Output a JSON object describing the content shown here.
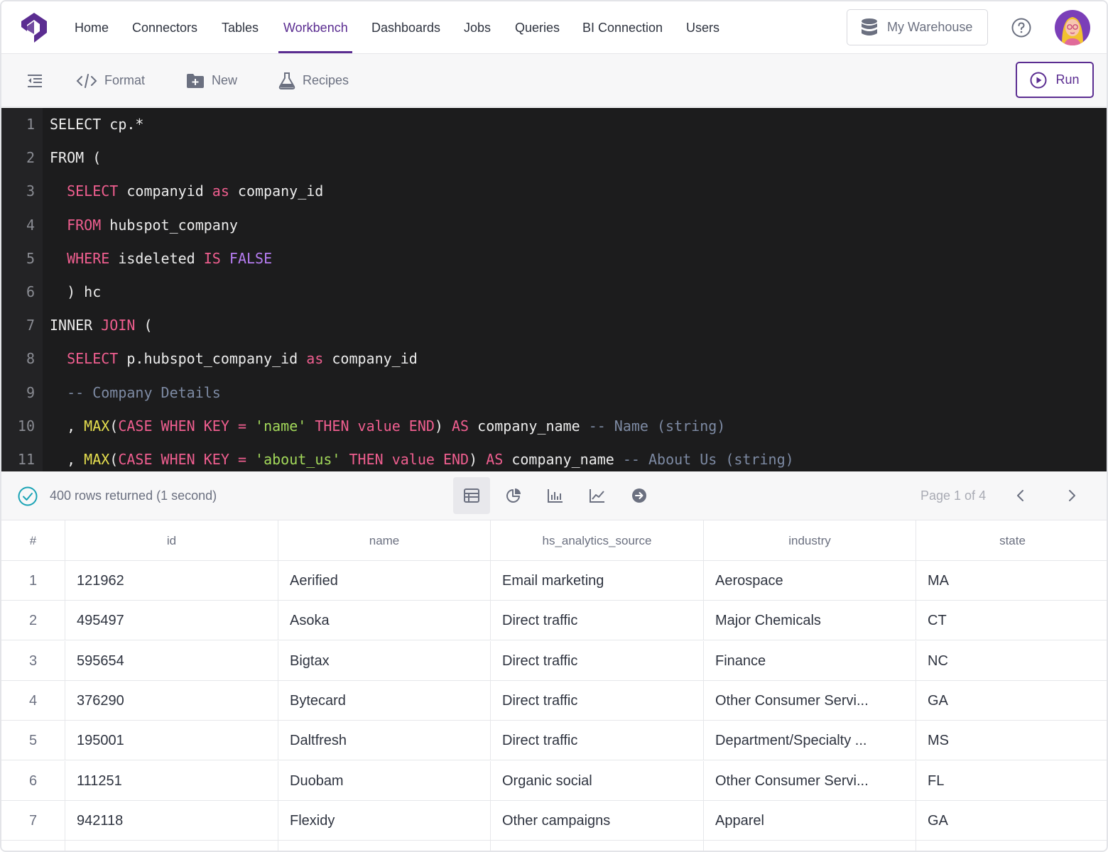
{
  "nav": {
    "items": [
      {
        "label": "Home",
        "active": false
      },
      {
        "label": "Connectors",
        "active": false
      },
      {
        "label": "Tables",
        "active": false
      },
      {
        "label": "Workbench",
        "active": true
      },
      {
        "label": "Dashboards",
        "active": false
      },
      {
        "label": "Jobs",
        "active": false
      },
      {
        "label": "Queries",
        "active": false
      },
      {
        "label": "BI Connection",
        "active": false
      },
      {
        "label": "Users",
        "active": false
      }
    ],
    "warehouse_label": "My Warehouse"
  },
  "toolbar": {
    "format_label": "Format",
    "new_label": "New",
    "recipes_label": "Recipes",
    "run_label": "Run"
  },
  "editor": {
    "lines": [
      {
        "n": "1",
        "tokens": [
          [
            "t",
            "SELECT cp.*"
          ]
        ]
      },
      {
        "n": "2",
        "tokens": [
          [
            "t",
            "FROM ("
          ]
        ]
      },
      {
        "n": "3",
        "tokens": [
          [
            "t",
            "  "
          ],
          [
            "kw",
            "SELECT"
          ],
          [
            "t",
            " companyid "
          ],
          [
            "kw",
            "as"
          ],
          [
            "t",
            " company_id"
          ]
        ]
      },
      {
        "n": "4",
        "tokens": [
          [
            "t",
            "  "
          ],
          [
            "kw",
            "FROM"
          ],
          [
            "t",
            " hubspot_company"
          ]
        ]
      },
      {
        "n": "5",
        "tokens": [
          [
            "t",
            "  "
          ],
          [
            "kw",
            "WHERE"
          ],
          [
            "t",
            " isdeleted "
          ],
          [
            "kw",
            "IS"
          ],
          [
            "t",
            " "
          ],
          [
            "bool",
            "FALSE"
          ]
        ]
      },
      {
        "n": "6",
        "tokens": [
          [
            "t",
            "  ) hc"
          ]
        ]
      },
      {
        "n": "7",
        "tokens": [
          [
            "t",
            "INNER "
          ],
          [
            "kw",
            "JOIN"
          ],
          [
            "t",
            " ("
          ]
        ]
      },
      {
        "n": "8",
        "tokens": [
          [
            "t",
            "  "
          ],
          [
            "kw",
            "SELECT"
          ],
          [
            "t",
            " p.hubspot_company_id "
          ],
          [
            "kw",
            "as"
          ],
          [
            "t",
            " company_id"
          ]
        ]
      },
      {
        "n": "9",
        "tokens": [
          [
            "cmt",
            "  -- Company Details"
          ]
        ]
      },
      {
        "n": "10",
        "tokens": [
          [
            "t",
            "  , "
          ],
          [
            "fn",
            "MAX"
          ],
          [
            "t",
            "("
          ],
          [
            "kw",
            "CASE WHEN KEY"
          ],
          [
            "t",
            " "
          ],
          [
            "kw",
            "="
          ],
          [
            "t",
            " "
          ],
          [
            "str",
            "'name'"
          ],
          [
            "t",
            " "
          ],
          [
            "kw",
            "THEN"
          ],
          [
            "t",
            " "
          ],
          [
            "kw",
            "value END"
          ],
          [
            "t",
            ") "
          ],
          [
            "kw",
            "AS"
          ],
          [
            "t",
            " company_name "
          ],
          [
            "cmt",
            "-- Name (string)"
          ]
        ]
      },
      {
        "n": "11",
        "tokens": [
          [
            "t",
            "  , "
          ],
          [
            "fn",
            "MAX"
          ],
          [
            "t",
            "("
          ],
          [
            "kw",
            "CASE WHEN KEY"
          ],
          [
            "t",
            " "
          ],
          [
            "kw",
            "="
          ],
          [
            "t",
            " "
          ],
          [
            "str",
            "'about_us'"
          ],
          [
            "t",
            " "
          ],
          [
            "kw",
            "THEN"
          ],
          [
            "t",
            " "
          ],
          [
            "kw",
            "value END"
          ],
          [
            "t",
            ") "
          ],
          [
            "kw",
            "AS"
          ],
          [
            "t",
            " company_name "
          ],
          [
            "cmt",
            "-- About Us (string)"
          ]
        ]
      }
    ]
  },
  "results": {
    "status": "400 rows returned (1 second)",
    "page": "Page 1 of 4",
    "columns": [
      "#",
      "id",
      "name",
      "hs_analytics_source",
      "industry",
      "state"
    ],
    "rows": [
      [
        "1",
        "121962",
        "Aerified",
        "Email marketing",
        "Aerospace",
        "MA"
      ],
      [
        "2",
        "495497",
        "Asoka",
        "Direct traffic",
        "Major Chemicals",
        "CT"
      ],
      [
        "3",
        "595654",
        "Bigtax",
        "Direct traffic",
        "Finance",
        "NC"
      ],
      [
        "4",
        "376290",
        "Bytecard",
        "Direct traffic",
        "Other Consumer Servi...",
        "GA"
      ],
      [
        "5",
        "195001",
        "Daltfresh",
        "Direct traffic",
        "Department/Specialty ...",
        "MS"
      ],
      [
        "6",
        "111251",
        "Duobam",
        "Organic social",
        "Other Consumer Servi...",
        "FL"
      ],
      [
        "7",
        "942118",
        "Flexidy",
        "Other campaigns",
        "Apparel",
        "GA"
      ]
    ]
  },
  "colors": {
    "accent": "#5b2d91",
    "editor_bg": "#1c1c1d",
    "keyword": "#ef5e8f",
    "success": "#1aa3b5"
  }
}
